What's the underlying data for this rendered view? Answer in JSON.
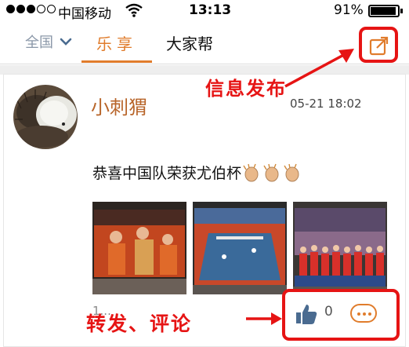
{
  "status_bar": {
    "carrier": "中国移动",
    "time": "13:13",
    "battery": "91%"
  },
  "nav": {
    "region": "全国",
    "tab_active": "乐享",
    "tab_other": "大家帮"
  },
  "post": {
    "username": "小刺猬",
    "timestamp": "05-21 18:02",
    "text": "恭喜中国队荣获尤伯杯",
    "like_count": "0",
    "partial_label": "1..."
  },
  "annotations": {
    "publish": "信息发布",
    "share_comment": "转发、评论"
  },
  "colors": {
    "accent": "#e07c2c",
    "annotation_red": "#e61414",
    "region_gray": "#8a97a8",
    "username": "#b8652a"
  }
}
